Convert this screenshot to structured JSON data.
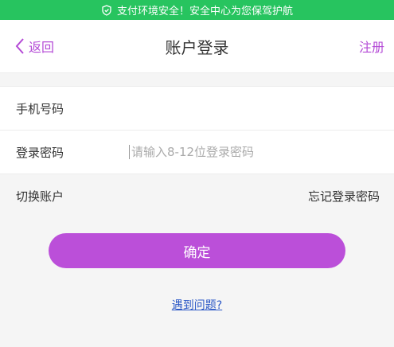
{
  "banner": {
    "text": "支付环境安全！安全中心为您保驾护航",
    "icon": "shield-icon"
  },
  "navbar": {
    "back_label": "返回",
    "title": "账户登录",
    "register_label": "注册"
  },
  "form": {
    "phone_label": "手机号码",
    "phone_value": "",
    "password_label": "登录密码",
    "password_placeholder": "请输入8-12位登录密码"
  },
  "links": {
    "switch_account": "切换账户",
    "forgot_password": "忘记登录密码"
  },
  "confirm_label": "确定",
  "help_link": "遇到问题?",
  "colors": {
    "accent": "#bb4fd9",
    "banner": "#27c45f",
    "link": "#2a57c6"
  }
}
